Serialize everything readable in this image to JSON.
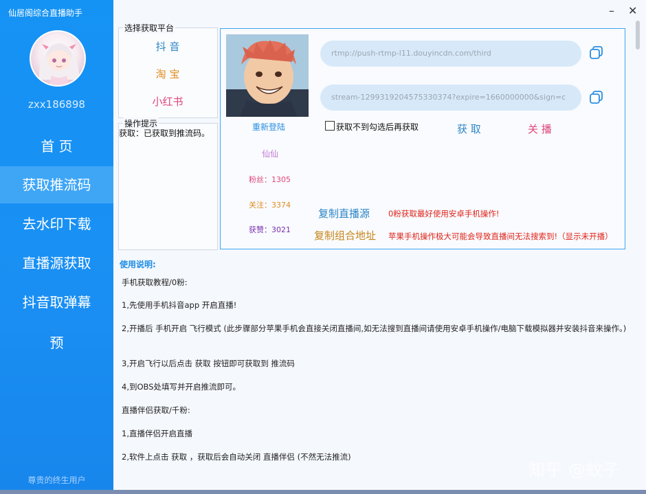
{
  "app": {
    "title": "仙居阁综合直播助手"
  },
  "user": {
    "name": "zxx186898",
    "footer": "尊贵的终生用户"
  },
  "nav": [
    {
      "label": "首 页"
    },
    {
      "label": "获取推流码"
    },
    {
      "label": "去水印下载"
    },
    {
      "label": "直播源获取"
    },
    {
      "label": "抖音取弹幕"
    },
    {
      "label": "预"
    }
  ],
  "platform_box": {
    "legend": "选择获取平台",
    "items": [
      {
        "label": "抖 音",
        "color": "#2e86c8"
      },
      {
        "label": "淘 宝",
        "color": "#e08a1e"
      },
      {
        "label": "小红书",
        "color": "#e0457a"
      }
    ]
  },
  "tips_box": {
    "legend": "操作提示",
    "text": "获取：已获取到推流码。"
  },
  "stream": {
    "relogin": "重新登陆",
    "nickname": "仙仙",
    "fans": "粉丝：1305",
    "follow": "关注：3374",
    "likes": "获赞：3021",
    "url1": "rtmp://push-rtmp-l11.douyincdn.com/third",
    "url2": "stream-1299319204575330374?expire=1660000000&sign=c",
    "checkbox_label": "获取不到勾选后再获取",
    "get_button": "获 取",
    "close_button": "关 播",
    "copy_source": "复制直播源",
    "copy_combined": "复制组合地址",
    "note1": "0粉获取最好使用安卓手机操作!",
    "note2": "苹果手机操作极大可能会导致直播间无法搜索到!（显示未开播）"
  },
  "instructions": {
    "title": "使用说明:",
    "lines": [
      "手机获取教程/0粉:",
      "1,先使用手机抖音app 开启直播!",
      "2,开播后 手机开启 飞行模式 (此步骤部分苹果手机会直接关闭直播间,如无法搜到直播间请使用安卓手机操作/电脑下载模拟器并安装抖音来操作。)",
      "3,开启飞行以后点击 获取 按钮即可获取到 推流码",
      "4,到OBS处填写并开启推流即可。",
      "直播伴侣获取/千粉:",
      "1,直播伴侣开启直播",
      "2,软件上点击 获取 ，获取后会自动关闭 直播伴侣 (不然无法推流)"
    ]
  },
  "watermark": "知乎 @蚊子",
  "colors": {
    "sidebar": "#1593f4",
    "accent": "#3ea5f0",
    "red": "#e0241b"
  }
}
